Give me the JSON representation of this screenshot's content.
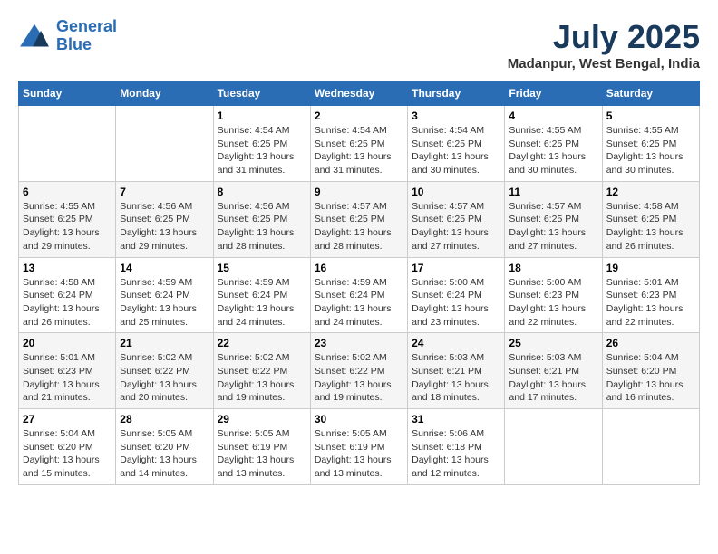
{
  "logo": {
    "line1": "General",
    "line2": "Blue"
  },
  "title": "July 2025",
  "location": "Madanpur, West Bengal, India",
  "days_of_week": [
    "Sunday",
    "Monday",
    "Tuesday",
    "Wednesday",
    "Thursday",
    "Friday",
    "Saturday"
  ],
  "weeks": [
    [
      {
        "day": "",
        "info": ""
      },
      {
        "day": "",
        "info": ""
      },
      {
        "day": "1",
        "info": "Sunrise: 4:54 AM\nSunset: 6:25 PM\nDaylight: 13 hours and 31 minutes."
      },
      {
        "day": "2",
        "info": "Sunrise: 4:54 AM\nSunset: 6:25 PM\nDaylight: 13 hours and 31 minutes."
      },
      {
        "day": "3",
        "info": "Sunrise: 4:54 AM\nSunset: 6:25 PM\nDaylight: 13 hours and 30 minutes."
      },
      {
        "day": "4",
        "info": "Sunrise: 4:55 AM\nSunset: 6:25 PM\nDaylight: 13 hours and 30 minutes."
      },
      {
        "day": "5",
        "info": "Sunrise: 4:55 AM\nSunset: 6:25 PM\nDaylight: 13 hours and 30 minutes."
      }
    ],
    [
      {
        "day": "6",
        "info": "Sunrise: 4:55 AM\nSunset: 6:25 PM\nDaylight: 13 hours and 29 minutes."
      },
      {
        "day": "7",
        "info": "Sunrise: 4:56 AM\nSunset: 6:25 PM\nDaylight: 13 hours and 29 minutes."
      },
      {
        "day": "8",
        "info": "Sunrise: 4:56 AM\nSunset: 6:25 PM\nDaylight: 13 hours and 28 minutes."
      },
      {
        "day": "9",
        "info": "Sunrise: 4:57 AM\nSunset: 6:25 PM\nDaylight: 13 hours and 28 minutes."
      },
      {
        "day": "10",
        "info": "Sunrise: 4:57 AM\nSunset: 6:25 PM\nDaylight: 13 hours and 27 minutes."
      },
      {
        "day": "11",
        "info": "Sunrise: 4:57 AM\nSunset: 6:25 PM\nDaylight: 13 hours and 27 minutes."
      },
      {
        "day": "12",
        "info": "Sunrise: 4:58 AM\nSunset: 6:25 PM\nDaylight: 13 hours and 26 minutes."
      }
    ],
    [
      {
        "day": "13",
        "info": "Sunrise: 4:58 AM\nSunset: 6:24 PM\nDaylight: 13 hours and 26 minutes."
      },
      {
        "day": "14",
        "info": "Sunrise: 4:59 AM\nSunset: 6:24 PM\nDaylight: 13 hours and 25 minutes."
      },
      {
        "day": "15",
        "info": "Sunrise: 4:59 AM\nSunset: 6:24 PM\nDaylight: 13 hours and 24 minutes."
      },
      {
        "day": "16",
        "info": "Sunrise: 4:59 AM\nSunset: 6:24 PM\nDaylight: 13 hours and 24 minutes."
      },
      {
        "day": "17",
        "info": "Sunrise: 5:00 AM\nSunset: 6:24 PM\nDaylight: 13 hours and 23 minutes."
      },
      {
        "day": "18",
        "info": "Sunrise: 5:00 AM\nSunset: 6:23 PM\nDaylight: 13 hours and 22 minutes."
      },
      {
        "day": "19",
        "info": "Sunrise: 5:01 AM\nSunset: 6:23 PM\nDaylight: 13 hours and 22 minutes."
      }
    ],
    [
      {
        "day": "20",
        "info": "Sunrise: 5:01 AM\nSunset: 6:23 PM\nDaylight: 13 hours and 21 minutes."
      },
      {
        "day": "21",
        "info": "Sunrise: 5:02 AM\nSunset: 6:22 PM\nDaylight: 13 hours and 20 minutes."
      },
      {
        "day": "22",
        "info": "Sunrise: 5:02 AM\nSunset: 6:22 PM\nDaylight: 13 hours and 19 minutes."
      },
      {
        "day": "23",
        "info": "Sunrise: 5:02 AM\nSunset: 6:22 PM\nDaylight: 13 hours and 19 minutes."
      },
      {
        "day": "24",
        "info": "Sunrise: 5:03 AM\nSunset: 6:21 PM\nDaylight: 13 hours and 18 minutes."
      },
      {
        "day": "25",
        "info": "Sunrise: 5:03 AM\nSunset: 6:21 PM\nDaylight: 13 hours and 17 minutes."
      },
      {
        "day": "26",
        "info": "Sunrise: 5:04 AM\nSunset: 6:20 PM\nDaylight: 13 hours and 16 minutes."
      }
    ],
    [
      {
        "day": "27",
        "info": "Sunrise: 5:04 AM\nSunset: 6:20 PM\nDaylight: 13 hours and 15 minutes."
      },
      {
        "day": "28",
        "info": "Sunrise: 5:05 AM\nSunset: 6:20 PM\nDaylight: 13 hours and 14 minutes."
      },
      {
        "day": "29",
        "info": "Sunrise: 5:05 AM\nSunset: 6:19 PM\nDaylight: 13 hours and 13 minutes."
      },
      {
        "day": "30",
        "info": "Sunrise: 5:05 AM\nSunset: 6:19 PM\nDaylight: 13 hours and 13 minutes."
      },
      {
        "day": "31",
        "info": "Sunrise: 5:06 AM\nSunset: 6:18 PM\nDaylight: 13 hours and 12 minutes."
      },
      {
        "day": "",
        "info": ""
      },
      {
        "day": "",
        "info": ""
      }
    ]
  ]
}
